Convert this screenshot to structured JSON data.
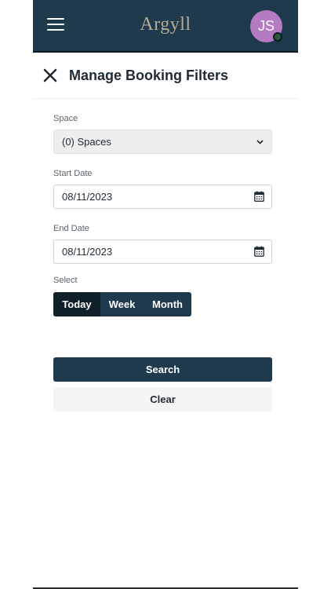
{
  "app": {
    "logo_text": "Argyll"
  },
  "user": {
    "initials": "JS"
  },
  "header": {
    "title": "Manage Booking Filters"
  },
  "form": {
    "space": {
      "label": "Space",
      "value": "(0) Spaces"
    },
    "start_date": {
      "label": "Start Date",
      "value": "08/11/2023"
    },
    "end_date": {
      "label": "End Date",
      "value": "08/11/2023"
    },
    "select": {
      "label": "Select",
      "options": [
        {
          "label": "Today",
          "active": true
        },
        {
          "label": "Week",
          "active": false
        },
        {
          "label": "Month",
          "active": false
        }
      ]
    }
  },
  "actions": {
    "search_label": "Search",
    "clear_label": "Clear"
  },
  "colors": {
    "primary": "#1e3a4c",
    "active_segment": "#0f2029",
    "avatar": "#b47ac2",
    "logo": "#b7ab92"
  }
}
